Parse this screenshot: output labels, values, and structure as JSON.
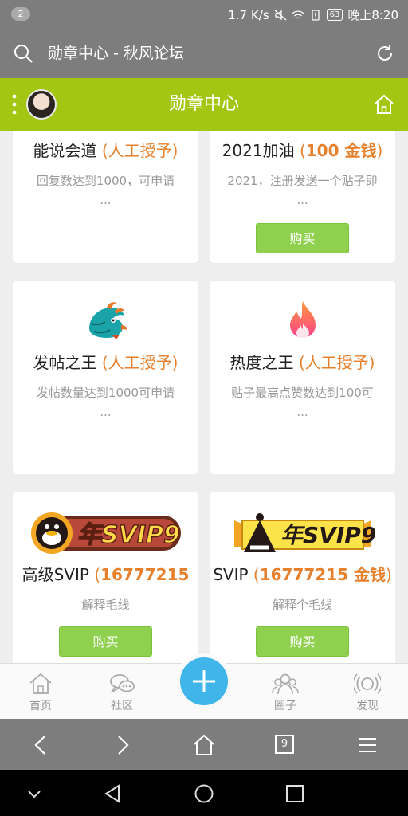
{
  "status_bar": {
    "notification_count": "2",
    "speed": "1.7 K/s",
    "battery": "63",
    "time": "晚上8:20"
  },
  "url_bar": {
    "title": "勋章中心 - 秋风论坛"
  },
  "header": {
    "title": "勋章中心"
  },
  "cards": [
    {
      "name_text": "能说会道",
      "price": "(人工授予)",
      "desc": "回复数达到1000，可申请\n...",
      "button": ""
    },
    {
      "name_text": "2021加油",
      "price_open": "(",
      "price_amount": "100 金钱",
      "price_close": ")",
      "desc": "2021，注册发送一个贴子即 ...",
      "button": "购买"
    },
    {
      "name_text": "发帖之王",
      "price": "(人工授予)",
      "desc": "发帖数量达到1000可申请\n...",
      "button": ""
    },
    {
      "name_text": "热度之王",
      "price": "(人工授予)",
      "desc": "贴子最高点赞数达到100可\n...",
      "button": ""
    },
    {
      "name_text": "高级SVIP",
      "price_open": "(",
      "price_amount": "16777215",
      "price_close": "",
      "desc": "解释毛线",
      "button": "购买",
      "badge_text": "年SVIP9"
    },
    {
      "name_text": "SVIP",
      "price_open": "(",
      "price_amount": "16777215 金钱",
      "price_close": ")",
      "desc": "解释个毛线",
      "button": "购买",
      "badge_text": "年SVIP9"
    }
  ],
  "bottom_nav": {
    "home": "首页",
    "community": "社区",
    "circle": "圈子",
    "discover": "发现"
  },
  "browser_bar": {
    "tab_count": "9"
  },
  "colors": {
    "header_green": "#a3c612",
    "price_orange": "#e6802d",
    "buy_green": "#8fd14f",
    "plus_blue": "#3fb5e9"
  }
}
